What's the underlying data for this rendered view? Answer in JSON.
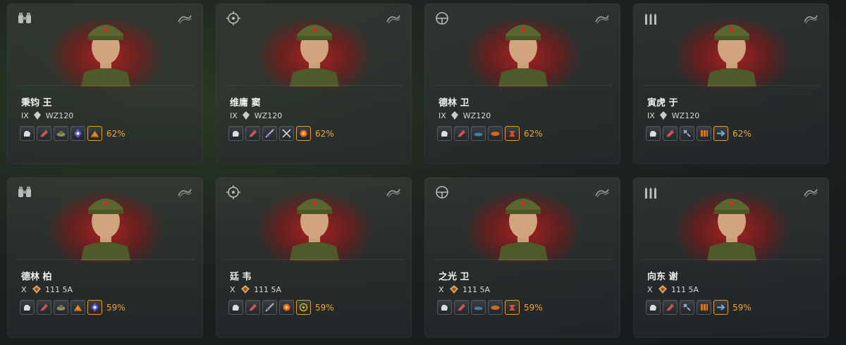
{
  "crew": [
    {
      "role_icon": "binoculars-icon",
      "name": "秉钧 王",
      "tier": "IX",
      "tank": "WZ120",
      "skills": [
        "brothers-in-arms-icon",
        "repairs-icon",
        "camouflage-icon",
        "sixth-sense-icon",
        "firefighting-icon"
      ],
      "percent": "62%"
    },
    {
      "role_icon": "gunner-icon",
      "name": "维庸 窦",
      "tier": "IX",
      "tank": "WZ120",
      "skills": [
        "brothers-in-arms-icon",
        "repairs-icon",
        "snap-shot-icon",
        "deadeye-icon",
        "designated-target-icon"
      ],
      "percent": "62%"
    },
    {
      "role_icon": "steering-wheel-icon",
      "name": "德林 卫",
      "tier": "IX",
      "tank": "WZ120",
      "skills": [
        "brothers-in-arms-icon",
        "repairs-icon",
        "smooth-ride-icon",
        "clutch-braking-icon",
        "off-road-icon"
      ],
      "percent": "62%"
    },
    {
      "role_icon": "shells-icon",
      "name": "寅虎 于",
      "tier": "IX",
      "tank": "WZ120",
      "skills": [
        "brothers-in-arms-icon",
        "repairs-icon",
        "safe-stowage-icon",
        "intuition-icon",
        "adrenaline-rush-icon"
      ],
      "percent": "62%"
    },
    {
      "role_icon": "binoculars-icon",
      "name": "德林 柏",
      "tier": "X",
      "tank": "111 5A",
      "skills": [
        "brothers-in-arms-icon",
        "repairs-icon",
        "camouflage-icon",
        "firefighting-icon",
        "sixth-sense-icon"
      ],
      "percent": "59%"
    },
    {
      "role_icon": "gunner-icon",
      "name": "廷 韦",
      "tier": "X",
      "tank": "111 5A",
      "skills": [
        "brothers-in-arms-icon",
        "repairs-icon",
        "snap-shot-icon",
        "designated-target-icon",
        "eagle-eye-icon"
      ],
      "percent": "59%"
    },
    {
      "role_icon": "steering-wheel-icon",
      "name": "之光 卫",
      "tier": "X",
      "tank": "111 5A",
      "skills": [
        "brothers-in-arms-icon",
        "repairs-icon",
        "smooth-ride-icon",
        "clutch-braking-icon",
        "off-road-icon"
      ],
      "percent": "59%"
    },
    {
      "role_icon": "shells-icon",
      "name": "向东 谢",
      "tier": "X",
      "tank": "111 5A",
      "skills": [
        "brothers-in-arms-icon",
        "repairs-icon",
        "safe-stowage-icon",
        "intuition-icon",
        "adrenaline-rush-icon"
      ],
      "percent": "59%"
    }
  ],
  "colors": {
    "accent_orange": "#f0a53a",
    "flag_red": "#b41e1e",
    "card_bg": "#3a4040"
  }
}
